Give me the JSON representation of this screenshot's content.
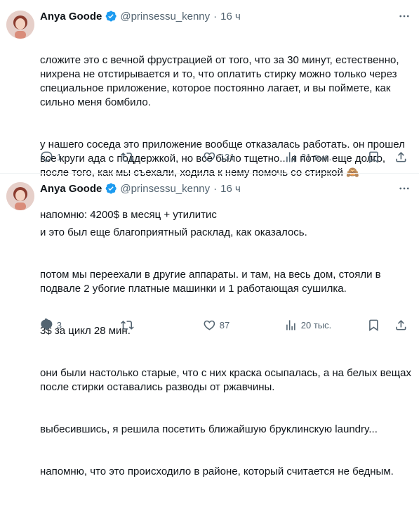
{
  "tweets": [
    {
      "author_name": "Anya Goode",
      "handle": "@prinsessu_kenny",
      "separator": "·",
      "time": "16 ч",
      "lines": [
        "сложите это с вечной фрустрацией от того, что за 30 минут, естественно, нихрена не отстирывается и то, что оплатить стирку можно только через специальное приложение, которое постоянно лагает, и вы поймете, как сильно меня бомбило.",
        "у нашего соседа это приложение вообще отказалась работать. он прошел все круги ада с поддержкой, но все было тщетно... я потом еще долго, после того, как мы съехали, ходила к нему помочь со стиркой 🙈",
        "напомню: 4200$ в месяц + утилитис"
      ],
      "replies": "1",
      "retweets": "",
      "likes": "131",
      "views": "21 тыс."
    },
    {
      "author_name": "Anya Goode",
      "handle": "@prinsessu_kenny",
      "separator": "·",
      "time": "16 ч",
      "lines": [
        "и это был еще благоприятный расклад, как оказалось.",
        "потом мы переехали в другие аппараты. и там, на весь дом, стояли в подвале 2 убогие платные машинки и 1 работающая сушилка.",
        "3$ за цикл 28 мин.",
        "они были настолько старые, что с них краска осыпалась, а на белых вещах после стирки оставались разводы от ржавчины.",
        "выбесившись, я решила посетить ближайшую бруклинскую laundry...",
        "напомню, что это происходило в районе, который считается не бедным."
      ],
      "replies": "3",
      "retweets": "",
      "likes": "87",
      "views": "20 тыс."
    }
  ],
  "icons": {
    "verified": "verified-badge-icon",
    "more": "more-icon",
    "reply": "reply-icon",
    "retweet": "retweet-icon",
    "like": "like-icon",
    "views": "views-icon",
    "bookmark": "bookmark-icon",
    "share": "share-icon"
  },
  "colors": {
    "text": "#0f1419",
    "secondary": "#536471",
    "verified": "#1d9bf0",
    "divider": "#eff3f4"
  }
}
